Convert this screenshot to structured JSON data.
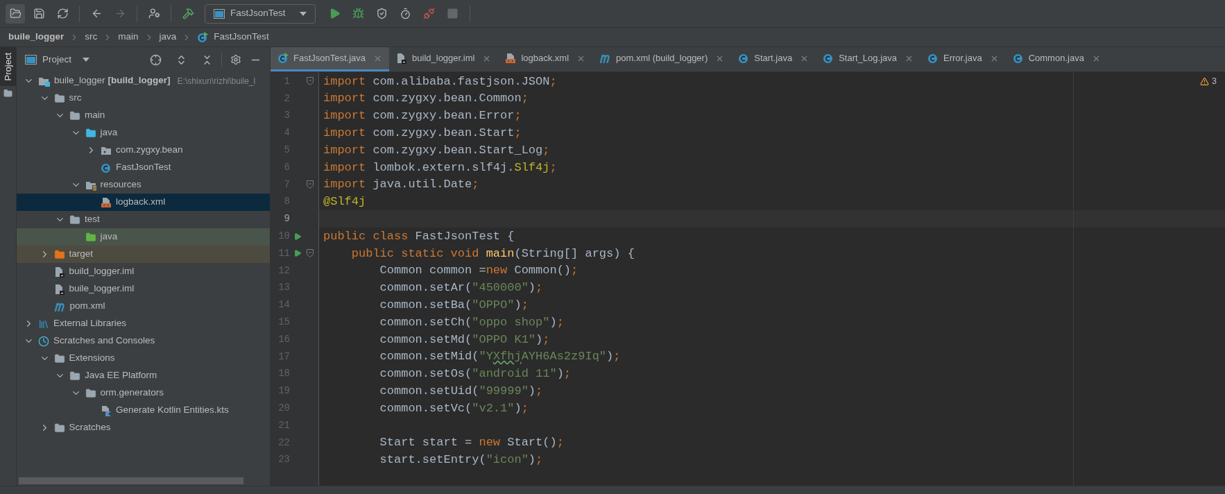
{
  "toolbar": {
    "buttons": [
      {
        "kind": "open",
        "disabled": false
      },
      {
        "kind": "save",
        "disabled": false
      },
      {
        "kind": "sync",
        "disabled": false
      },
      {
        "kind": "back",
        "disabled": false
      },
      {
        "kind": "forward",
        "disabled": true
      },
      {
        "kind": "vcs-user",
        "disabled": false
      },
      {
        "kind": "build",
        "disabled": false
      }
    ],
    "run_config": "FastJsonTest",
    "run_buttons": [
      {
        "kind": "run",
        "disabled": false
      },
      {
        "kind": "debug",
        "disabled": false
      },
      {
        "kind": "coverage",
        "disabled": false
      },
      {
        "kind": "profile",
        "disabled": false
      },
      {
        "kind": "attach",
        "disabled": false
      },
      {
        "kind": "stop",
        "disabled": true
      }
    ]
  },
  "breadcrumbs": [
    {
      "label": "buile_logger",
      "kind": "project"
    },
    {
      "label": "src",
      "kind": "folder"
    },
    {
      "label": "main",
      "kind": "folder"
    },
    {
      "label": "java",
      "kind": "folder"
    },
    {
      "label": "FastJsonTest",
      "kind": "class"
    }
  ],
  "side_strip": {
    "label": "Project",
    "selected": true
  },
  "project_panel": {
    "title": "Project",
    "tree": [
      {
        "label": "buile_logger",
        "module": "[build_logger]",
        "path": "E:\\shixun\\rizhi\\buile_l",
        "kind": "module",
        "expanded": true,
        "selected": false,
        "children": [
          {
            "label": "src",
            "kind": "folder",
            "expanded": true,
            "selected": false,
            "children": [
              {
                "label": "main",
                "kind": "folder",
                "expanded": true,
                "selected": false,
                "children": [
                  {
                    "label": "java",
                    "kind": "source-folder",
                    "expanded": true,
                    "selected": false,
                    "children": [
                      {
                        "label": "com.zygxy.bean",
                        "kind": "package",
                        "expanded": false,
                        "selected": false
                      },
                      {
                        "label": "FastJsonTest",
                        "kind": "class",
                        "selected": false
                      }
                    ]
                  },
                  {
                    "label": "resources",
                    "kind": "resources",
                    "expanded": true,
                    "selected": false,
                    "children": [
                      {
                        "label": "logback.xml",
                        "kind": "xml",
                        "selected": true
                      }
                    ]
                  }
                ]
              },
              {
                "label": "test",
                "kind": "folder",
                "expanded": true,
                "selected": false,
                "children": [
                  {
                    "label": "java",
                    "kind": "test-folder",
                    "selected": false
                  }
                ]
              }
            ]
          },
          {
            "label": "target",
            "kind": "excluded-folder",
            "expanded": false,
            "selected": false
          },
          {
            "label": "build_logger.iml",
            "kind": "iml",
            "selected": false
          },
          {
            "label": "buile_logger.iml",
            "kind": "iml",
            "selected": false
          },
          {
            "label": "pom.xml",
            "kind": "maven",
            "selected": false
          }
        ]
      },
      {
        "label": "External Libraries",
        "kind": "libraries",
        "expanded": false,
        "selected": false
      },
      {
        "label": "Scratches and Consoles",
        "kind": "scratches",
        "expanded": true,
        "selected": false,
        "children": [
          {
            "label": "Extensions",
            "kind": "folder",
            "expanded": true,
            "selected": false,
            "children": [
              {
                "label": "Java EE Platform",
                "kind": "folder",
                "expanded": true,
                "selected": false,
                "children": [
                  {
                    "label": "orm.generators",
                    "kind": "folder",
                    "expanded": true,
                    "selected": false,
                    "children": [
                      {
                        "label": "Generate Kotlin Entities.kts",
                        "kind": "kotlin",
                        "selected": false
                      }
                    ]
                  }
                ]
              }
            ]
          },
          {
            "label": "Scratches",
            "kind": "folder",
            "expanded": false,
            "selected": false
          }
        ]
      }
    ]
  },
  "tabs": [
    {
      "label": "FastJsonTest.java",
      "kind": "class-run",
      "selected": true
    },
    {
      "label": "build_logger.iml",
      "kind": "iml",
      "selected": false
    },
    {
      "label": "logback.xml",
      "kind": "xml",
      "selected": false
    },
    {
      "label": "pom.xml (build_logger)",
      "kind": "maven",
      "selected": false
    },
    {
      "label": "Start.java",
      "kind": "class",
      "selected": false
    },
    {
      "label": "Start_Log.java",
      "kind": "class",
      "selected": false
    },
    {
      "label": "Error.java",
      "kind": "class",
      "selected": false
    },
    {
      "label": "Common.java",
      "kind": "class",
      "selected": false
    }
  ],
  "editor": {
    "warnings": "3",
    "lines": [
      {
        "number": "1",
        "fold": true,
        "run": false,
        "current": false,
        "tokens": [
          {
            "kind": "keyword",
            "text": "import"
          },
          {
            "kind": "plain",
            "text": " com.alibaba.fastjson.JSON"
          },
          {
            "kind": "keyword",
            "text": ";"
          }
        ]
      },
      {
        "number": "2",
        "fold": false,
        "run": false,
        "current": false,
        "tokens": [
          {
            "kind": "keyword",
            "text": "import"
          },
          {
            "kind": "plain",
            "text": " com.zygxy.bean.Common"
          },
          {
            "kind": "keyword",
            "text": ";"
          }
        ]
      },
      {
        "number": "3",
        "fold": false,
        "run": false,
        "current": false,
        "tokens": [
          {
            "kind": "keyword",
            "text": "import"
          },
          {
            "kind": "plain",
            "text": " com.zygxy.bean.Error"
          },
          {
            "kind": "keyword",
            "text": ";"
          }
        ]
      },
      {
        "number": "4",
        "fold": false,
        "run": false,
        "current": false,
        "tokens": [
          {
            "kind": "keyword",
            "text": "import"
          },
          {
            "kind": "plain",
            "text": " com.zygxy.bean.Start"
          },
          {
            "kind": "keyword",
            "text": ";"
          }
        ]
      },
      {
        "number": "5",
        "fold": false,
        "run": false,
        "current": false,
        "tokens": [
          {
            "kind": "keyword",
            "text": "import"
          },
          {
            "kind": "plain",
            "text": " com.zygxy.bean.Start_Log"
          },
          {
            "kind": "keyword",
            "text": ";"
          }
        ]
      },
      {
        "number": "6",
        "fold": false,
        "run": false,
        "current": false,
        "tokens": [
          {
            "kind": "keyword",
            "text": "import"
          },
          {
            "kind": "plain",
            "text": " lombok.extern.slf4j."
          },
          {
            "kind": "annotation",
            "text": "Slf4j"
          },
          {
            "kind": "keyword",
            "text": ";"
          }
        ]
      },
      {
        "number": "7",
        "fold": true,
        "run": false,
        "current": false,
        "tokens": [
          {
            "kind": "keyword",
            "text": "import"
          },
          {
            "kind": "plain",
            "text": " java.util.Date"
          },
          {
            "kind": "keyword",
            "text": ";"
          }
        ]
      },
      {
        "number": "8",
        "fold": false,
        "run": false,
        "current": false,
        "tokens": [
          {
            "kind": "annotation",
            "text": "@Slf4j"
          }
        ]
      },
      {
        "number": "9",
        "fold": false,
        "run": false,
        "current": true
      },
      {
        "number": "10",
        "fold": false,
        "run": true,
        "current": false,
        "tokens": [
          {
            "kind": "keyword",
            "text": "public class"
          },
          {
            "kind": "plain",
            "text": " FastJsonTest {"
          }
        ],
        "children": [
          {
            "number": "11",
            "fold": true,
            "run": true,
            "current": false,
            "tokens": [
              {
                "kind": "keyword",
                "text": "public static void "
              },
              {
                "kind": "method",
                "text": "main"
              },
              {
                "kind": "plain",
                "text": "(String[] args) {"
              }
            ],
            "children": [
              {
                "number": "12",
                "fold": false,
                "run": false,
                "current": false,
                "tokens": [
                  {
                    "kind": "plain",
                    "text": "Common common ="
                  },
                  {
                    "kind": "keyword",
                    "text": "new"
                  },
                  {
                    "kind": "plain",
                    "text": " Common()"
                  },
                  {
                    "kind": "keyword",
                    "text": ";"
                  }
                ]
              },
              {
                "number": "13",
                "fold": false,
                "run": false,
                "current": false,
                "tokens": [
                  {
                    "kind": "plain",
                    "text": "common.setAr("
                  },
                  {
                    "kind": "string",
                    "text": "\"450000\""
                  },
                  {
                    "kind": "plain",
                    "text": ")"
                  },
                  {
                    "kind": "keyword",
                    "text": ";"
                  }
                ]
              },
              {
                "number": "14",
                "fold": false,
                "run": false,
                "current": false,
                "tokens": [
                  {
                    "kind": "plain",
                    "text": "common.setBa("
                  },
                  {
                    "kind": "string",
                    "text": "\"OPPO\""
                  },
                  {
                    "kind": "plain",
                    "text": ")"
                  },
                  {
                    "kind": "keyword",
                    "text": ";"
                  }
                ]
              },
              {
                "number": "15",
                "fold": false,
                "run": false,
                "current": false,
                "tokens": [
                  {
                    "kind": "plain",
                    "text": "common.setCh("
                  },
                  {
                    "kind": "string",
                    "text": "\"oppo shop\""
                  },
                  {
                    "kind": "plain",
                    "text": ")"
                  },
                  {
                    "kind": "keyword",
                    "text": ";"
                  }
                ]
              },
              {
                "number": "16",
                "fold": false,
                "run": false,
                "current": false,
                "tokens": [
                  {
                    "kind": "plain",
                    "text": "common.setMd("
                  },
                  {
                    "kind": "string",
                    "text": "\"OPPO K1\""
                  },
                  {
                    "kind": "plain",
                    "text": ")"
                  },
                  {
                    "kind": "keyword",
                    "text": ";"
                  }
                ]
              },
              {
                "number": "17",
                "fold": false,
                "run": false,
                "current": false,
                "tokens": [
                  {
                    "kind": "plain",
                    "text": "common.setMid("
                  },
                  {
                    "kind": "string",
                    "text": "\"Y"
                  },
                  {
                    "kind": "typo",
                    "text": "Xfhj"
                  },
                  {
                    "kind": "string",
                    "text": "AYH6As2z9Iq\""
                  },
                  {
                    "kind": "plain",
                    "text": ")"
                  },
                  {
                    "kind": "keyword",
                    "text": ";"
                  }
                ]
              },
              {
                "number": "18",
                "fold": false,
                "run": false,
                "current": false,
                "tokens": [
                  {
                    "kind": "plain",
                    "text": "common.setOs("
                  },
                  {
                    "kind": "string",
                    "text": "\"android 11\""
                  },
                  {
                    "kind": "plain",
                    "text": ")"
                  },
                  {
                    "kind": "keyword",
                    "text": ";"
                  }
                ]
              },
              {
                "number": "19",
                "fold": false,
                "run": false,
                "current": false,
                "tokens": [
                  {
                    "kind": "plain",
                    "text": "common.setUid("
                  },
                  {
                    "kind": "string",
                    "text": "\"99999\""
                  },
                  {
                    "kind": "plain",
                    "text": ")"
                  },
                  {
                    "kind": "keyword",
                    "text": ";"
                  }
                ]
              },
              {
                "number": "20",
                "fold": false,
                "run": false,
                "current": false,
                "tokens": [
                  {
                    "kind": "plain",
                    "text": "common.setVc("
                  },
                  {
                    "kind": "string",
                    "text": "\"v2.1\""
                  },
                  {
                    "kind": "plain",
                    "text": ")"
                  },
                  {
                    "kind": "keyword",
                    "text": ";"
                  }
                ]
              },
              {
                "number": "21",
                "fold": false,
                "run": false,
                "current": false
              },
              {
                "number": "22",
                "fold": false,
                "run": false,
                "current": false,
                "tokens": [
                  {
                    "kind": "plain",
                    "text": "Start start = "
                  },
                  {
                    "kind": "keyword",
                    "text": "new"
                  },
                  {
                    "kind": "plain",
                    "text": " Start()"
                  },
                  {
                    "kind": "keyword",
                    "text": ";"
                  }
                ]
              },
              {
                "number": "23",
                "fold": false,
                "run": false,
                "current": false,
                "tokens": [
                  {
                    "kind": "plain",
                    "text": "start.setEntry("
                  },
                  {
                    "kind": "string",
                    "text": "\"icon\""
                  },
                  {
                    "kind": "plain",
                    "text": ")"
                  },
                  {
                    "kind": "keyword",
                    "text": ";"
                  }
                ]
              }
            ]
          }
        ]
      }
    ]
  }
}
